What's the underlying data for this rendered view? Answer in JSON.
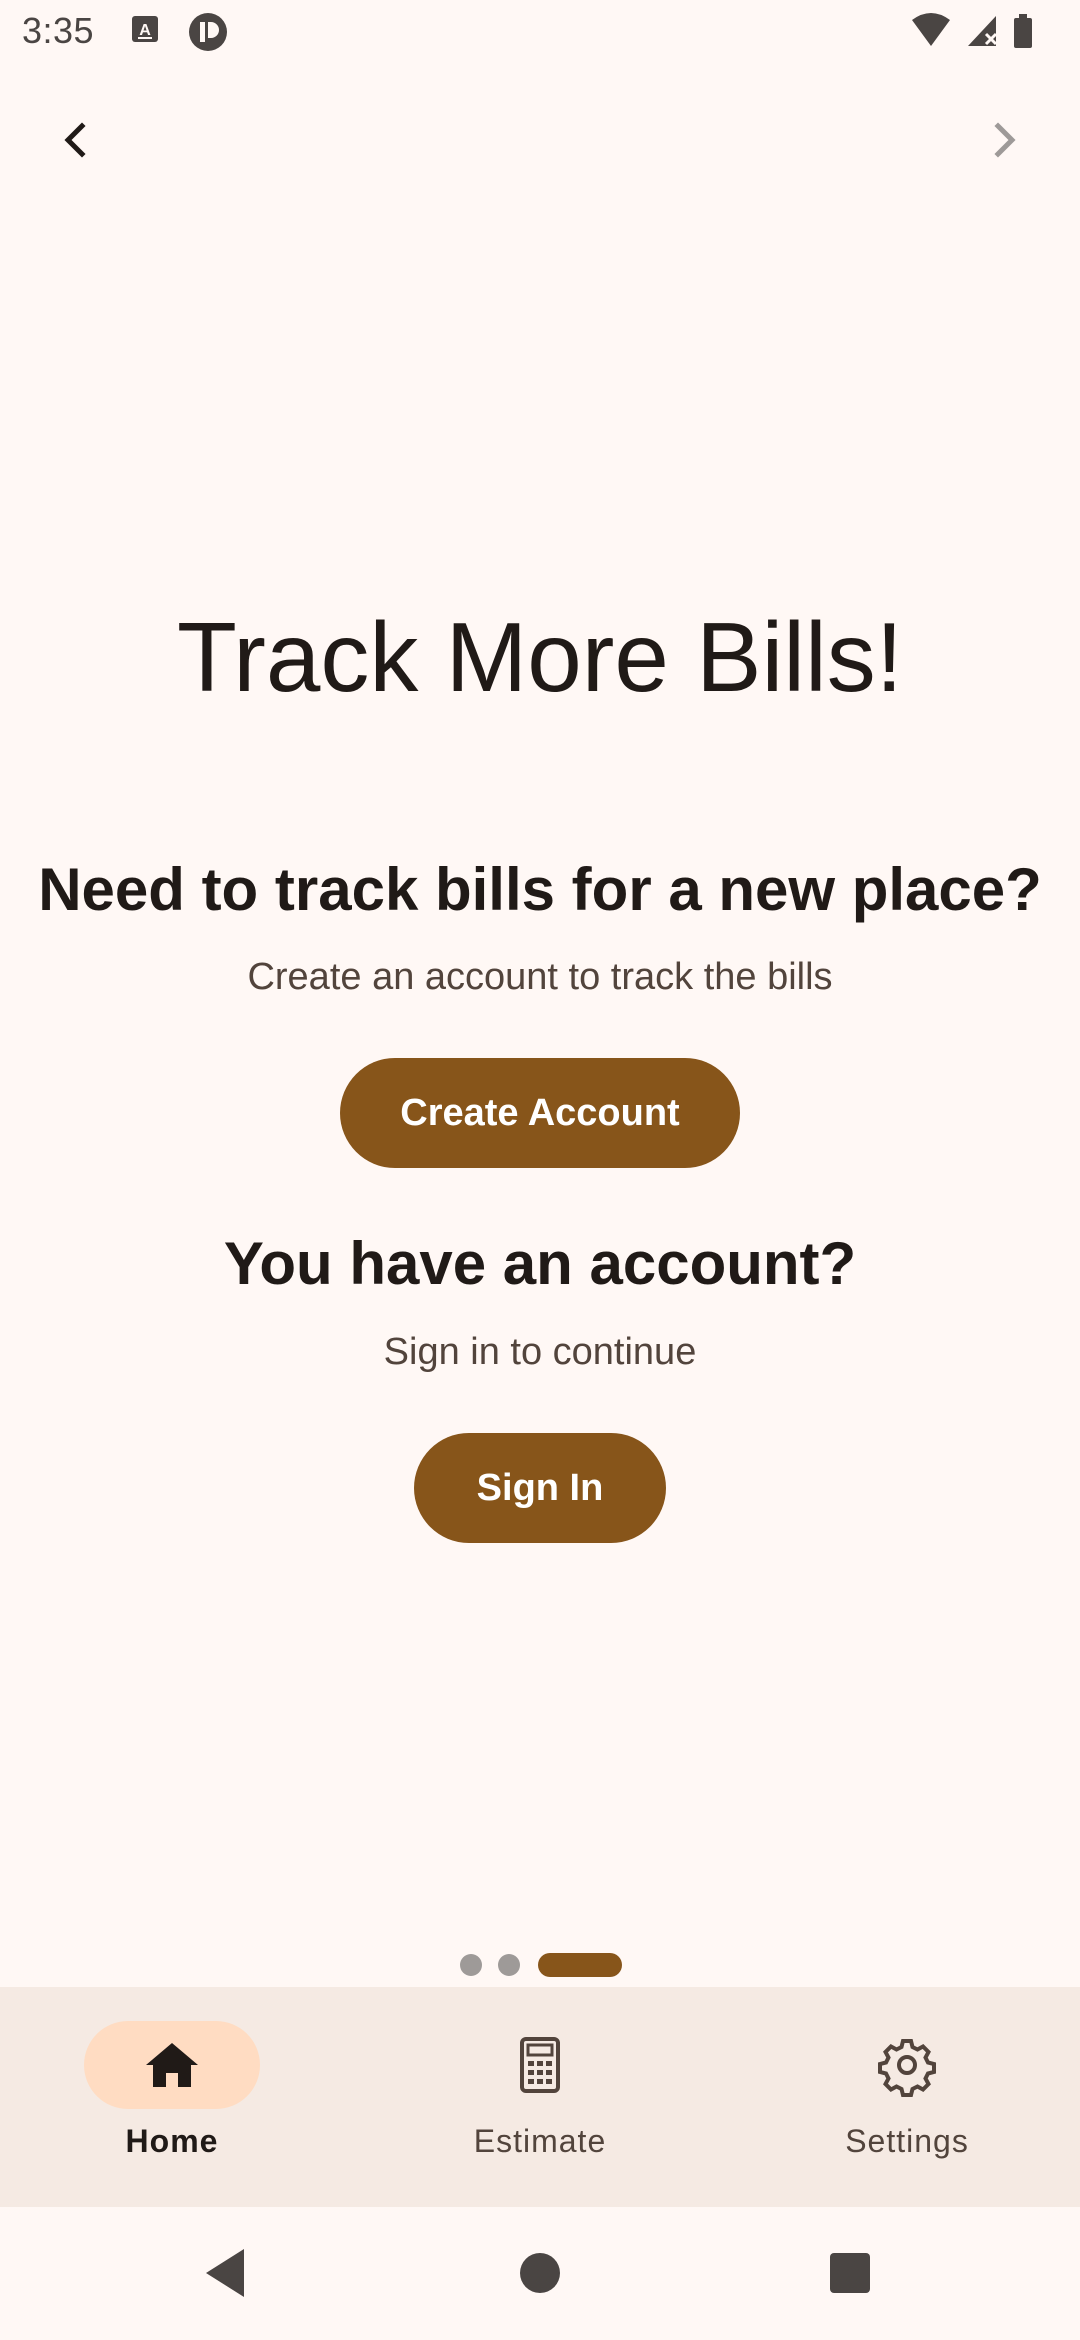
{
  "status_bar": {
    "time": "3:35"
  },
  "top_nav": {
    "back_icon": "chevron-left-icon",
    "forward_icon": "chevron-right-icon"
  },
  "main": {
    "title": "Track More Bills!",
    "create_section": {
      "heading": "Need to track bills for a new place?",
      "subtext": "Create an account to track the bills",
      "button_label": "Create Account"
    },
    "signin_section": {
      "heading": "You have an account?",
      "subtext": "Sign in to continue",
      "button_label": "Sign In"
    }
  },
  "pager": {
    "page_count": 3,
    "current_page": 3
  },
  "bottom_nav": {
    "items": [
      {
        "label": "Home",
        "icon": "home-icon",
        "active": true
      },
      {
        "label": "Estimate",
        "icon": "calculator-icon",
        "active": false
      },
      {
        "label": "Settings",
        "icon": "gear-icon",
        "active": false
      }
    ]
  },
  "colors": {
    "background": "#FFF8F5",
    "accent": "#87551A",
    "nav_background": "#F5EAE3",
    "nav_active_indicator": "#FFDCC2"
  }
}
